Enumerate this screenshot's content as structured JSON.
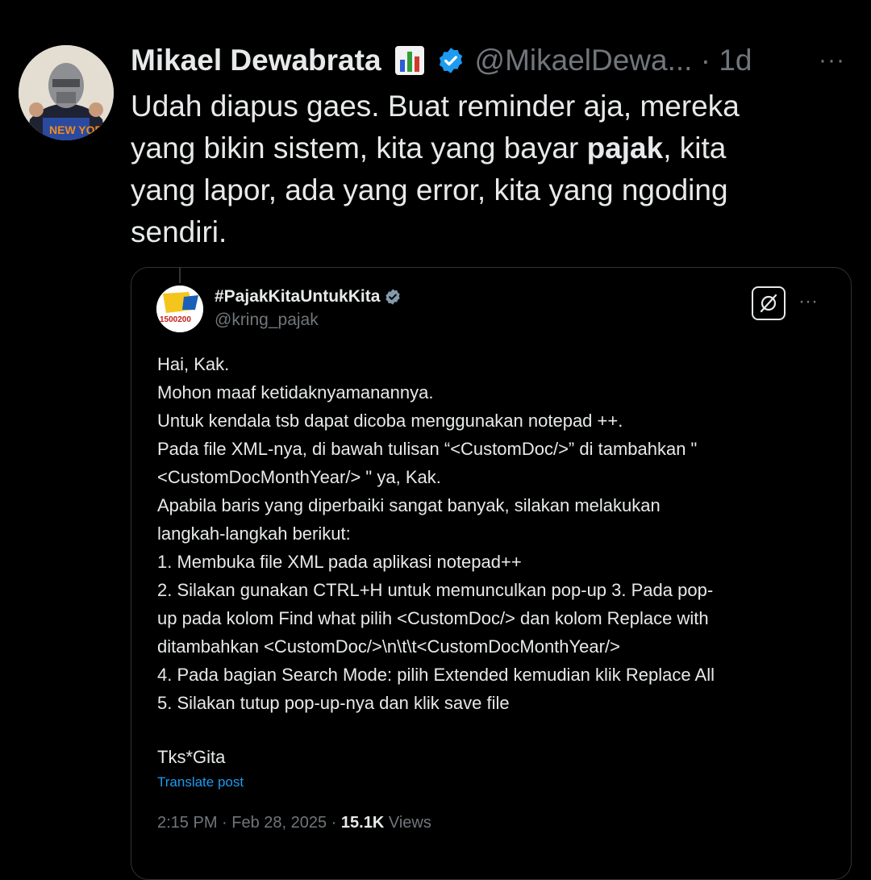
{
  "post": {
    "author_name": "Mikael Dewabrata",
    "author_handle": "@MikaelDewa...",
    "time": "1d",
    "text_before": "Udah diapus gaes. Buat reminder aja, mereka\nyang bikin sistem, kita yang bayar ",
    "text_bold": "pajak",
    "text_after": ", kita\nyang lapor, ada yang error, kita yang ngoding\nsendiri.",
    "more_label": "···"
  },
  "quote": {
    "author_name": "#PajakKitaUntukKita",
    "author_handle": "@kring_pajak",
    "avatar_label": "1500200",
    "more_label": "···",
    "lines": [
      "Hai, Kak.",
      "Mohon maaf ketidaknyamanannya.",
      "Untuk kendala tsb dapat dicoba menggunakan notepad ++.",
      "Pada file XML-nya, di bawah tulisan “<CustomDoc/>” di tambahkan \"",
      "<CustomDocMonthYear/> \" ya, Kak.",
      "Apabila baris yang diperbaiki sangat banyak, silakan melakukan",
      "langkah-langkah berikut:",
      "1. Membuka file XML pada aplikasi notepad++",
      "2. Silakan gunakan CTRL+H untuk memunculkan pop-up 3. Pada pop-",
      "up pada kolom Find what pilih <CustomDoc/> dan kolom Replace with",
      "ditambahkan <CustomDoc/>\\n\\t\\t<CustomDocMonthYear/>",
      "4. Pada bagian Search Mode: pilih Extended kemudian klik Replace All",
      "5. Silakan tutup pop-up-nya dan klik save file"
    ],
    "signature": "Tks*Gita",
    "translate_label": "Translate post",
    "timestamp": "2:15 PM · Feb 28, 2025 · ",
    "views_count": "15.1K",
    "views_label": " Views"
  },
  "colors": {
    "background": "#000000",
    "text": "#e7e9ea",
    "muted": "#71767b",
    "accent": "#1d9bf0"
  },
  "icons": [
    "chart-emoji-icon",
    "verified-badge-icon",
    "grok-icon",
    "more-icon"
  ]
}
